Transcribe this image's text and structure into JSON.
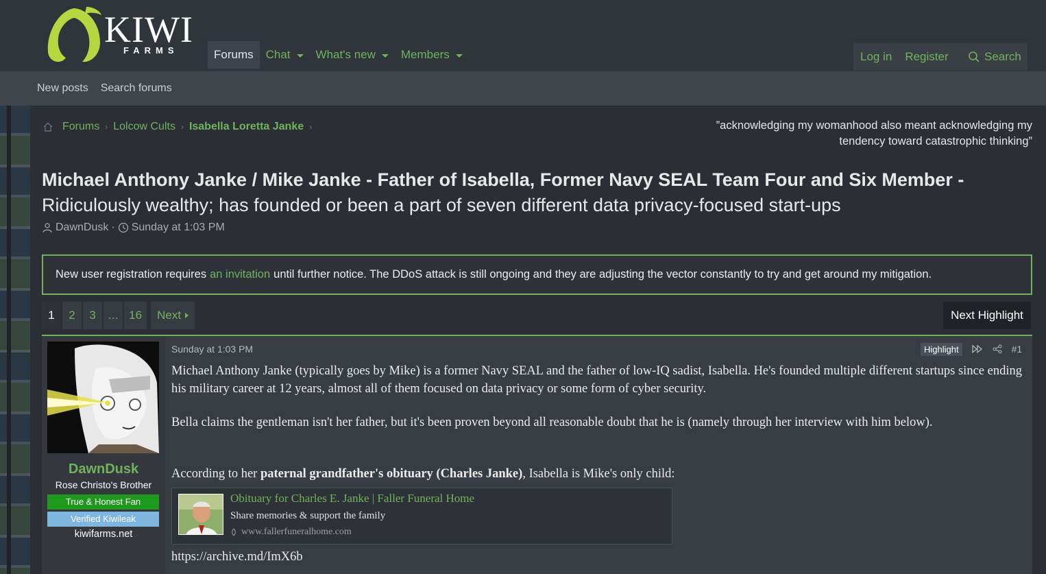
{
  "brand": {
    "name": "KIWI",
    "sub": "FARMS",
    "accent": "#6fb35c"
  },
  "nav": {
    "forums": "Forums",
    "chat": "Chat",
    "whats_new": "What's new",
    "members": "Members",
    "login": "Log in",
    "register": "Register",
    "search": "Search"
  },
  "subnav": {
    "new_posts": "New posts",
    "search_forums": "Search forums"
  },
  "breadcrumb": {
    "home_icon": "home-icon",
    "items": [
      "Forums",
      "Lolcow Cults",
      "Isabella Loretta Janke"
    ]
  },
  "tagline": "”acknowledging my womanhood also meant acknowledging my tendency toward catastrophic thinking”",
  "thread": {
    "title_bold": "Michael Anthony Janke / Mike Janke - Father of Isabella, Former Navy SEAL Team Four and Six Member -",
    "title_rest": "Ridiculously wealthy; has founded or been a part of seven different data privacy-focused start-ups",
    "author": "DawnDusk",
    "sep": "·",
    "date": "Sunday at 1:03 PM"
  },
  "notice": {
    "before": "New user registration requires",
    "link": "an invitation",
    "after": "until further notice. The DDoS attack is still ongoing and they are adjusting the vector constantly to try and get around my mitigation."
  },
  "pagination": {
    "pages": [
      "1",
      "2",
      "3",
      "...",
      "16"
    ],
    "current": "1",
    "next": "Next",
    "next_highlight": "Next Highlight"
  },
  "post": {
    "user": {
      "name": "DawnDusk",
      "title": "Rose Christo's Brother",
      "badge1": "True & Honest Fan",
      "badge2": "Verified Kiwileak",
      "site": "kiwifarms.net"
    },
    "date": "Sunday at 1:03 PM",
    "highlight": "Highlight",
    "number": "#1",
    "para1": "Michael Anthony Janke (typically goes by Mike) is a former Navy SEAL and the father of low-IQ sadist, Isabella. He's founded multiple different startups since ending his military career at 12 years, almost all of them focused on data privacy or some form of cyber security.",
    "para2": "Bella claims the gentleman isn't her father, but it's been proven beyond all reasonable doubt that he is (namely through her interview with him below).",
    "para3_before": "According to her",
    "para3_bold": "paternal grandfather's obituary (Charles Janke)",
    "para3_after": ", Isabella is Mike's only child:",
    "embed": {
      "title": "Obituary for Charles E. Janke | Faller Funeral Home",
      "desc": "Share memories & support the family",
      "url": "www.fallerfuneralhome.com"
    },
    "archive": "https://archive.md/ImX6b"
  }
}
